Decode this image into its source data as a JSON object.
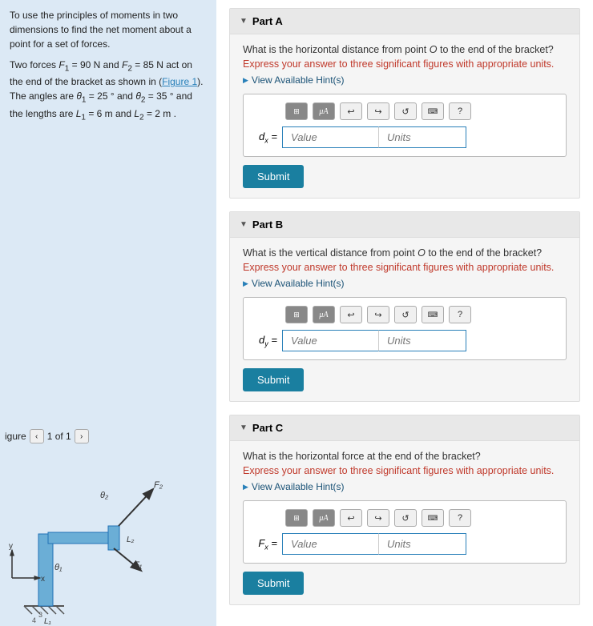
{
  "leftPanel": {
    "description1": "To use the principles of moments in two dimensions to find the net moment about a point for a set of forces.",
    "description2": "Two forces F₁ = 90 N and F₂ = 85 N act on the end of the bracket as shown in (Figure 1). The angles are θ₁ = 25° and θ₂ = 35° and the lengths are L₁ = 6 m and L₂ = 2 m.",
    "figureLabel": "igure",
    "pageNav": "1 of 1"
  },
  "parts": [
    {
      "id": "A",
      "label": "Part A",
      "question": "What is the horizontal distance from point O to the end of the bracket?",
      "note": "Express your answer to three significant figures with appropriate units.",
      "hint": "View Available Hint(s)",
      "inputLabel": "dₓ =",
      "valuePlaceholder": "Value",
      "unitsPlaceholder": "Units",
      "submitLabel": "Submit"
    },
    {
      "id": "B",
      "label": "Part B",
      "question": "What is the vertical distance from point O to the end of the bracket?",
      "note": "Express your answer to three significant figures with appropriate units.",
      "hint": "View Available Hint(s)",
      "inputLabel": "d_y =",
      "valuePlaceholder": "Value",
      "unitsPlaceholder": "Units",
      "submitLabel": "Submit"
    },
    {
      "id": "C",
      "label": "Part C",
      "question": "What is the horizontal force at the end of the bracket?",
      "note": "Express your answer to three significant figures with appropriate units.",
      "hint": "View Available Hint(s)",
      "inputLabel": "Fₓ =",
      "valuePlaceholder": "Value",
      "unitsPlaceholder": "Units",
      "submitLabel": "Submit"
    }
  ],
  "toolbar": {
    "gridIcon": "⊞",
    "muIcon": "μΑ",
    "undoIcon": "↩",
    "redoIcon": "↪",
    "refreshIcon": "↺",
    "keyboardIcon": "⌨",
    "helpIcon": "?"
  }
}
